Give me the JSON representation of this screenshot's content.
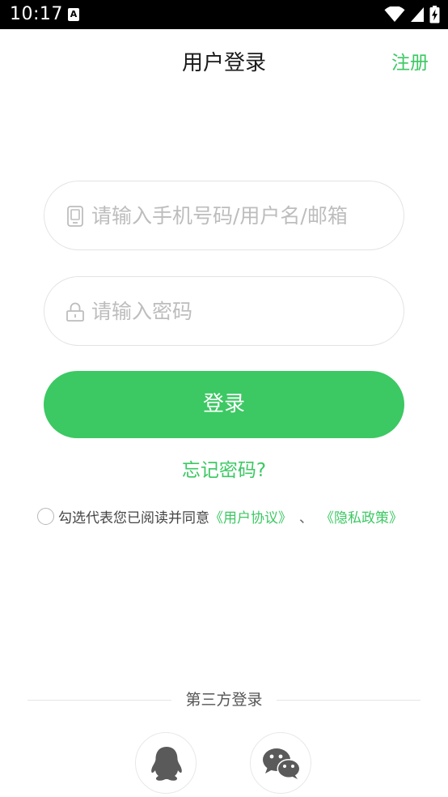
{
  "status_bar": {
    "time": "10:17",
    "notification_icon": "a-letter-icon",
    "icons": [
      "wifi-icon",
      "signal-icon",
      "battery-charging-icon"
    ]
  },
  "header": {
    "title": "用户登录",
    "register_label": "注册"
  },
  "form": {
    "username_placeholder": "请输入手机号码/用户名/邮箱",
    "username_icon": "phone-icon",
    "password_placeholder": "请输入密码",
    "password_icon": "lock-icon",
    "login_label": "登录",
    "forgot_label": "忘记密码?"
  },
  "agreement": {
    "text": "勾选代表您已阅读并同意",
    "user_agreement": "《用户协议》",
    "separator": "、",
    "privacy_policy": "《隐私政策》",
    "checked": false
  },
  "third_party": {
    "title": "第三方登录",
    "providers": [
      "qq-icon",
      "wechat-icon"
    ]
  },
  "colors": {
    "accent": "#3cc863",
    "status_bar": "#000000",
    "placeholder": "#bdbdbd",
    "border": "#e3e3e3",
    "social_icon": "#5a5a5a"
  }
}
